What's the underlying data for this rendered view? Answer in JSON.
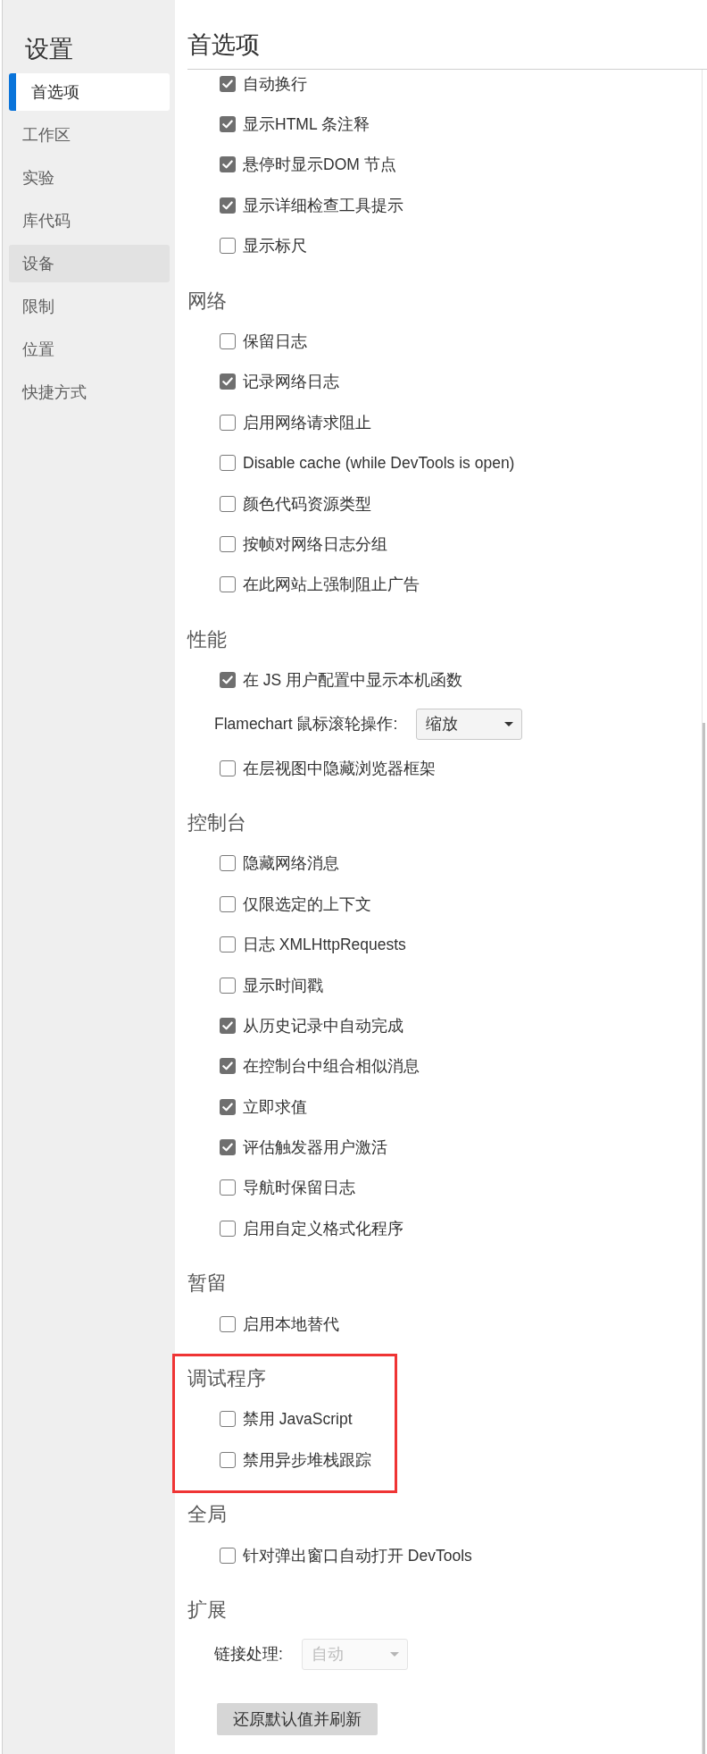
{
  "sidebar": {
    "title": "设置",
    "items": [
      {
        "label": "首选项",
        "selected": true,
        "hovered": false
      },
      {
        "label": "工作区",
        "selected": false,
        "hovered": false
      },
      {
        "label": "实验",
        "selected": false,
        "hovered": false
      },
      {
        "label": "库代码",
        "selected": false,
        "hovered": false
      },
      {
        "label": "设备",
        "selected": false,
        "hovered": true
      },
      {
        "label": "限制",
        "selected": false,
        "hovered": false
      },
      {
        "label": "位置",
        "selected": false,
        "hovered": false
      },
      {
        "label": "快捷方式",
        "selected": false,
        "hovered": false
      }
    ]
  },
  "panel": {
    "title": "首选项",
    "sections": [
      {
        "highlighted": false,
        "items": [
          {
            "kind": "checkbox",
            "label": "自动换行",
            "checked": true
          },
          {
            "kind": "checkbox",
            "label": "显示HTML 条注释",
            "checked": true
          },
          {
            "kind": "checkbox",
            "label": "悬停时显示DOM 节点",
            "checked": true
          },
          {
            "kind": "checkbox",
            "label": "显示详细检查工具提示",
            "checked": true
          },
          {
            "kind": "checkbox",
            "label": "显示标尺",
            "checked": false
          }
        ]
      },
      {
        "heading": "网络",
        "highlighted": false,
        "items": [
          {
            "kind": "checkbox",
            "label": "保留日志",
            "checked": false
          },
          {
            "kind": "checkbox",
            "label": "记录网络日志",
            "checked": true
          },
          {
            "kind": "checkbox",
            "label": "启用网络请求阻止",
            "checked": false
          },
          {
            "kind": "checkbox",
            "label": "Disable cache (while DevTools is open)",
            "checked": false
          },
          {
            "kind": "checkbox",
            "label": "颜色代码资源类型",
            "checked": false
          },
          {
            "kind": "checkbox",
            "label": "按帧对网络日志分组",
            "checked": false
          },
          {
            "kind": "checkbox",
            "label": "在此网站上强制阻止广告",
            "checked": false
          }
        ]
      },
      {
        "heading": "性能",
        "highlighted": false,
        "items": [
          {
            "kind": "checkbox",
            "label": "在 JS 用户配置中显示本机函数",
            "checked": true
          },
          {
            "kind": "dropdown",
            "label": "Flamechart 鼠标滚轮操作:",
            "value": "缩放",
            "disabled": false
          },
          {
            "kind": "checkbox",
            "label": "在层视图中隐藏浏览器框架",
            "checked": false
          }
        ]
      },
      {
        "heading": "控制台",
        "highlighted": false,
        "items": [
          {
            "kind": "checkbox",
            "label": "隐藏网络消息",
            "checked": false
          },
          {
            "kind": "checkbox",
            "label": "仅限选定的上下文",
            "checked": false
          },
          {
            "kind": "checkbox",
            "label": "日志 XMLHttpRequests",
            "checked": false
          },
          {
            "kind": "checkbox",
            "label": "显示时间戳",
            "checked": false
          },
          {
            "kind": "checkbox",
            "label": "从历史记录中自动完成",
            "checked": true
          },
          {
            "kind": "checkbox",
            "label": "在控制台中组合相似消息",
            "checked": true
          },
          {
            "kind": "checkbox",
            "label": "立即求值",
            "checked": true
          },
          {
            "kind": "checkbox",
            "label": "评估触发器用户激活",
            "checked": true
          },
          {
            "kind": "checkbox",
            "label": "导航时保留日志",
            "checked": false
          },
          {
            "kind": "checkbox",
            "label": "启用自定义格式化程序",
            "checked": false
          }
        ]
      },
      {
        "heading": "暂留",
        "highlighted": false,
        "items": [
          {
            "kind": "checkbox",
            "label": "启用本地替代",
            "checked": false
          }
        ]
      },
      {
        "heading": "调试程序",
        "highlighted": true,
        "items": [
          {
            "kind": "checkbox",
            "label": "禁用 JavaScript",
            "checked": false
          },
          {
            "kind": "checkbox",
            "label": "禁用异步堆栈跟踪",
            "checked": false
          }
        ]
      },
      {
        "heading": "全局",
        "highlighted": false,
        "items": [
          {
            "kind": "checkbox",
            "label": "针对弹出窗口自动打开 DevTools",
            "checked": false
          }
        ]
      },
      {
        "heading": "扩展",
        "highlighted": false,
        "items": [
          {
            "kind": "dropdown",
            "label": "链接处理:",
            "value": "自动",
            "disabled": true
          }
        ]
      }
    ],
    "reset_button": {
      "label": "还原默认值并刷新"
    }
  }
}
